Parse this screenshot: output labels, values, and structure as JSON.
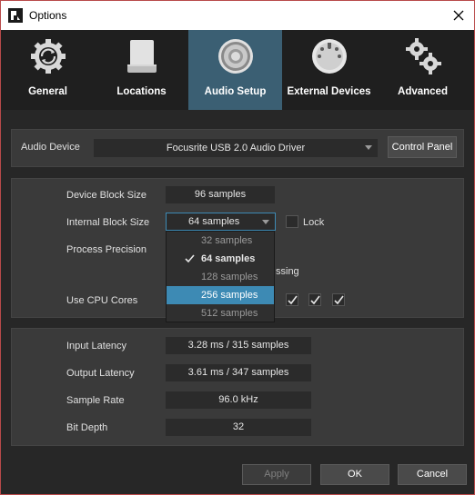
{
  "window": {
    "title": "Options"
  },
  "tabs": [
    {
      "label": "General",
      "icon": "gear-refresh-icon"
    },
    {
      "label": "Locations",
      "icon": "drive-icon"
    },
    {
      "label": "Audio Setup",
      "icon": "speaker-icon",
      "active": true
    },
    {
      "label": "External Devices",
      "icon": "midi-port-icon"
    },
    {
      "label": "Advanced",
      "icon": "gears-icon"
    }
  ],
  "audio_device": {
    "label": "Audio Device",
    "value": "Focusrite USB 2.0 Audio Driver",
    "control_panel_label": "Control Panel"
  },
  "processing": {
    "device_block_size": {
      "label": "Device Block Size",
      "value": "96 samples"
    },
    "internal_block_size": {
      "label": "Internal Block Size",
      "value": "64 samples"
    },
    "lock_label": "Lock",
    "process_precision_label": "Process Precision",
    "partial_text": "ssing",
    "use_cpu_cores_label": "Use CPU Cores"
  },
  "block_size_options": [
    {
      "label": "32 samples"
    },
    {
      "label": "64 samples",
      "selected": true
    },
    {
      "label": "128 samples"
    },
    {
      "label": "256 samples",
      "hovered": true
    },
    {
      "label": "512 samples"
    }
  ],
  "latency": {
    "input": {
      "label": "Input Latency",
      "value": "3.28 ms / 315 samples"
    },
    "output": {
      "label": "Output Latency",
      "value": "3.61 ms / 347 samples"
    },
    "sample_rate": {
      "label": "Sample Rate",
      "value": "96.0 kHz"
    },
    "bit_depth": {
      "label": "Bit Depth",
      "value": "32"
    }
  },
  "footer": {
    "apply": "Apply",
    "ok": "OK",
    "cancel": "Cancel"
  },
  "colors": {
    "accent": "#3b5f73",
    "highlight": "#3d8ab4",
    "border": "#b84a4a"
  }
}
